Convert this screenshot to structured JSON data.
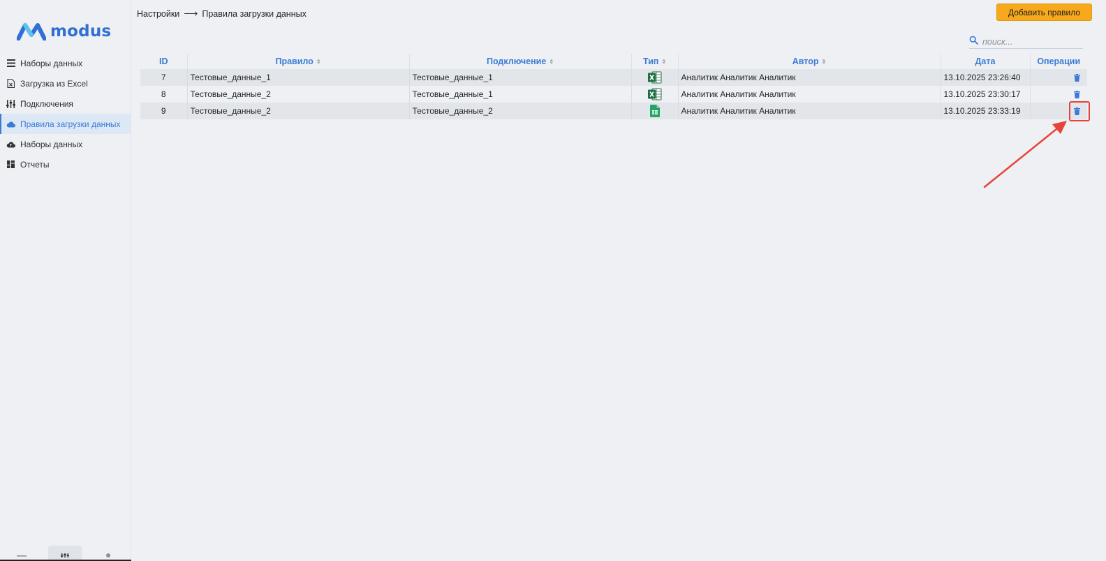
{
  "app": {
    "logo_text": "modus"
  },
  "sidebar": {
    "items": [
      {
        "label": "Наборы данных",
        "icon": "list-icon",
        "active": false
      },
      {
        "label": "Загрузка из Excel",
        "icon": "excel-file-icon",
        "active": false
      },
      {
        "label": "Подключения",
        "icon": "sliders-icon",
        "active": false
      },
      {
        "label": "Правила загрузки данных",
        "icon": "cloud-icon",
        "active": true
      },
      {
        "label": "Наборы данных",
        "icon": "cloud-upload-icon",
        "active": false
      },
      {
        "label": "Отчеты",
        "icon": "dashboard-icon",
        "active": false
      }
    ]
  },
  "header": {
    "breadcrumb_root": "Настройки",
    "breadcrumb_arrow": "⟶",
    "breadcrumb_current": "Правила загрузки данных",
    "add_button": "Добавить правило",
    "search_placeholder": "поиск..."
  },
  "table": {
    "columns": [
      "ID",
      "Правило",
      "Подключение",
      "Тип",
      "Автор",
      "Дата",
      "Операции"
    ],
    "sortable": [
      false,
      true,
      true,
      true,
      true,
      false,
      false
    ],
    "rows": [
      {
        "id": "7",
        "rule": "Тестовые_данные_1",
        "connection": "Тестовые_данные_1",
        "type": "excel",
        "author": "Аналитик Аналитик Аналитик",
        "date": "13.10.2025 23:26:40"
      },
      {
        "id": "8",
        "rule": "Тестовые_данные_2",
        "connection": "Тестовые_данные_1",
        "type": "excel",
        "author": "Аналитик Аналитик Аналитик",
        "date": "13.10.2025 23:30:17"
      },
      {
        "id": "9",
        "rule": "Тестовые_данные_2",
        "connection": "Тестовые_данные_2",
        "type": "google-sheets",
        "author": "Аналитик Аналитик Аналитик",
        "date": "13.10.2025 23:33:19"
      }
    ]
  },
  "colors": {
    "accent": "#3a7bd5",
    "button": "#f7a81b",
    "annotation": "#e8423a",
    "excel": "#1d6f42",
    "sheets": "#23a566"
  }
}
